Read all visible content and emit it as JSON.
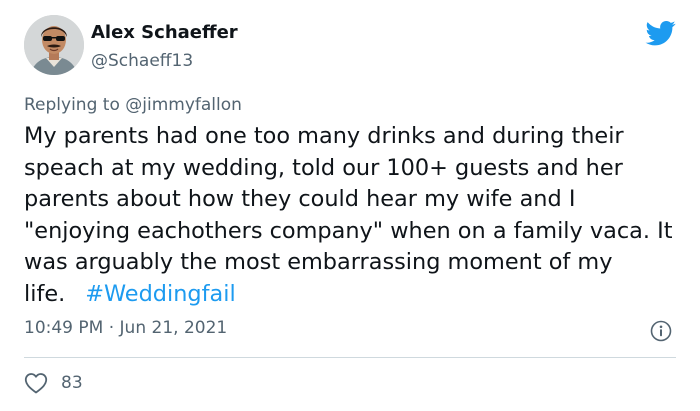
{
  "author": {
    "name": "Alex Schaeffer",
    "handle": "@Schaeff13"
  },
  "reply": {
    "prefix": "Replying to",
    "mention": "@jimmyfallon"
  },
  "tweet": {
    "text": "My parents had one too many drinks and during their speach at my wedding, told our 100+ guests and her parents about how they could hear my wife and I \"enjoying eachothers company\" when on a family vaca. It was arguably the most embarrassing moment of my life.",
    "hashtag": "#Weddingfail"
  },
  "meta": {
    "time": "10:49 PM",
    "separator": "·",
    "date": "Jun 21, 2021"
  },
  "actions": {
    "like_count": "83"
  },
  "icons": {
    "brand": "twitter-bird-icon",
    "info": "info-icon",
    "like": "heart-icon"
  },
  "colors": {
    "brand_blue": "#1d9bf0",
    "text": "#0f1419",
    "secondary": "#536471",
    "divider": "#cfd9de"
  }
}
